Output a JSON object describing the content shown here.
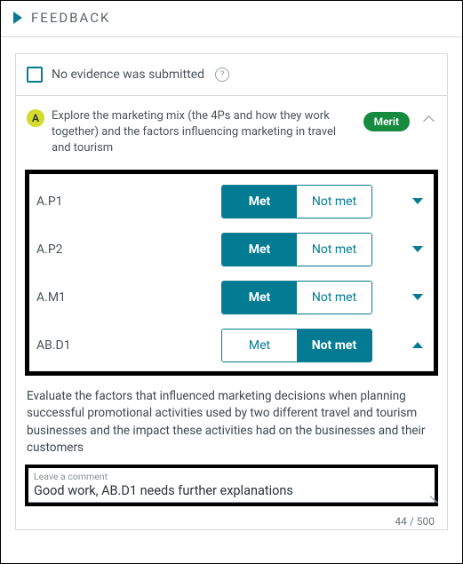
{
  "header": {
    "title": "FEEDBACK"
  },
  "evidence": {
    "label": "No evidence was submitted"
  },
  "criterion": {
    "letter": "A",
    "text": "Explore the marketing mix (the 4Ps and how they work together) and the factors influencing marketing in travel and tourism",
    "badge": "Merit"
  },
  "labels": {
    "met": "Met",
    "not_met": "Not met"
  },
  "rows": [
    {
      "code": "A.P1",
      "selected": "met",
      "expanded": false
    },
    {
      "code": "A.P2",
      "selected": "met",
      "expanded": false
    },
    {
      "code": "A.M1",
      "selected": "met",
      "expanded": false
    },
    {
      "code": "AB.D1",
      "selected": "not_met",
      "expanded": true
    }
  ],
  "description": "Evaluate the factors that influenced marketing decisions when planning successful promotional activities used by two different travel and tourism businesses and the impact these activities had on the businesses and their customers",
  "comment": {
    "placeholder": "Leave a comment",
    "value": "Good work, AB.D1 needs further explanations",
    "counter": "44 / 500"
  }
}
